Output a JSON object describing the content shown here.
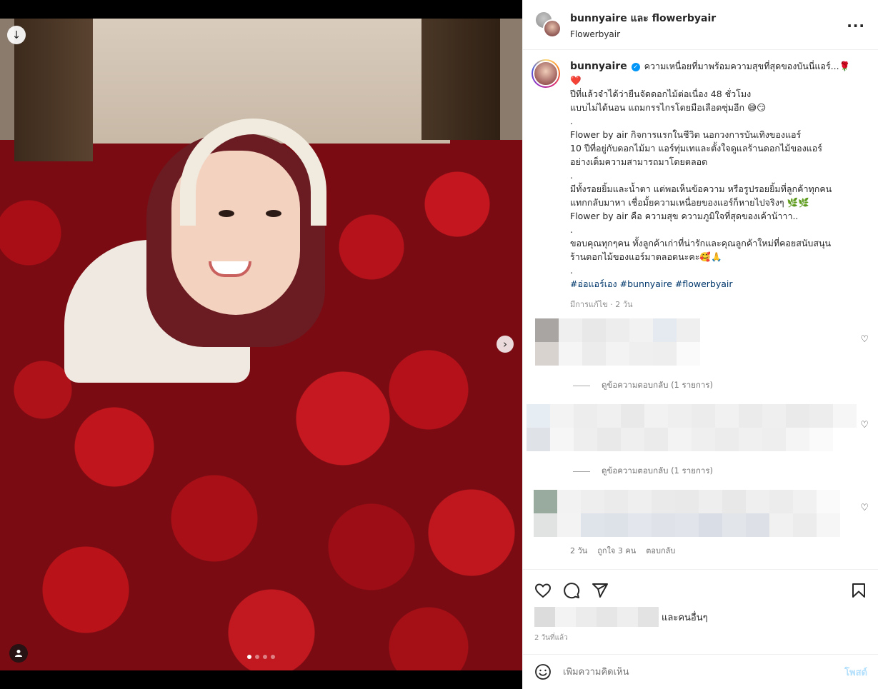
{
  "header": {
    "names": "bunnyaire และ flowerbyair",
    "subtitle": "Flowerbyair",
    "more_icon": "more-horizontal-icon"
  },
  "media": {
    "slide_count": 4,
    "active_slide": 1,
    "download_icon": "download-arrow-icon",
    "next_icon": "chevron-right-icon",
    "tag_icon": "user-tag-icon"
  },
  "caption": {
    "username": "bunnyaire",
    "verified": true,
    "lines": [
      "ความเหนื่อยที่มาพร้อมความสุขที่สุดของบันนี่แอร์...🌹",
      "❤️",
      "ปีที่แล้วจำได้ว่ายืนจัดดอกไม้ต่อเนื่อง 48 ชั่วโมง",
      "แบบไม่ได้นอน แถมกรรไกรโดยมือเลือดซุ่มอีก 😅😏",
      ".",
      "Flower by air กิจการแรกในชีวิต นอกวงการบันเทิงของแอร์",
      "10 ปีที่อยู่กับดอกไม้มา แอร์ทุ่มเทและตั้งใจดูแลร้านดอกไม้ของแอร์",
      "อย่างเต็มความสามารถมาโดยตลอด",
      ".",
      "มีทั้งรอยยิ้มและน้ำตา แต่พอเห็นข้อความ หรือรูปรอยยิ้มที่ลูกค้าทุกคน",
      "แทกกลับมาหา เชื่อมั้ยความเหนื่อยของแอร์ก็หายไปจริงๆ 🌿🌿",
      "Flower by air คือ ความสุข ความภูมิใจที่สุดของเค้าน้าาา..",
      ".",
      "ขอบคุณทุกๆคน ทั้งลูกค้าเก่าที่น่ารักและคุณลูกค้าใหม่ที่คอยสนับสนุน",
      "ร้านดอกไม้ของแอร์มาตลอดนะคะ🥰🙏",
      "."
    ],
    "hashtags": "#อ่อแอร์เอง #bunnyaire #flowerbyair",
    "meta": "มีการแก้ไข · 2 วัน"
  },
  "comments": {
    "view_replies_1": "ดูข้อความตอบกลับ (1 รายการ)",
    "view_replies_2": "ดูข้อความตอบกลับ (1 รายการ)",
    "third_time": "2 วัน",
    "third_likes": "ถูกใจ 3 คน",
    "third_reply": "ตอบกลับ",
    "heart_icon": "heart-outline-icon"
  },
  "actions": {
    "like_icon": "heart-icon",
    "comment_icon": "comment-icon",
    "share_icon": "send-icon",
    "save_icon": "bookmark-icon",
    "likes_suffix": "และคนอื่นๆ",
    "time_ago": "2 วันที่แล้ว"
  },
  "composer": {
    "placeholder": "เพิ่มความคิดเห็น",
    "post_label": "โพสต์",
    "emoji_icon": "smiley-icon"
  }
}
